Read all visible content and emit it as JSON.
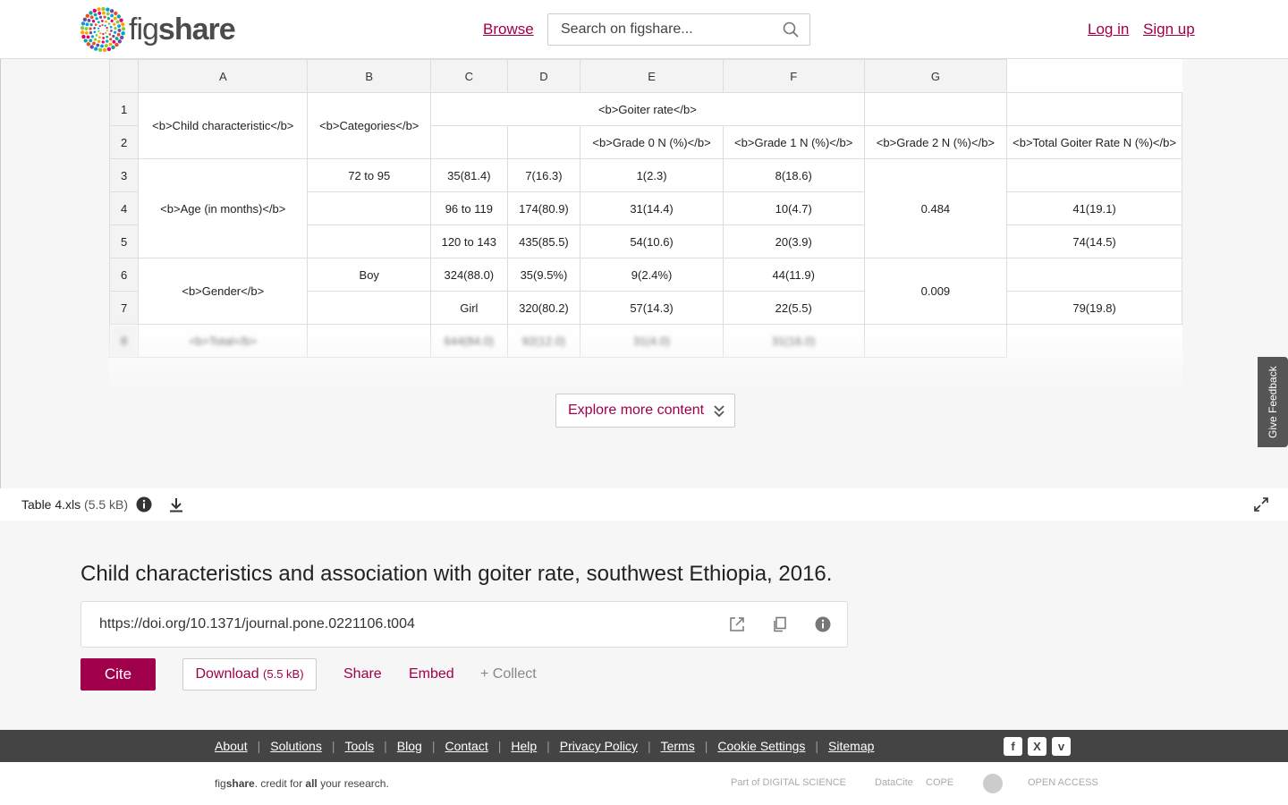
{
  "header": {
    "logo_prefix": "fig",
    "logo_suffix": "share",
    "browse": "Browse",
    "search_placeholder": "Search on figshare...",
    "login": "Log in",
    "signup": "Sign up"
  },
  "sheet": {
    "columns": [
      "A",
      "B",
      "C",
      "D",
      "E",
      "F",
      "G"
    ],
    "row_numbers": [
      "1",
      "2",
      "3",
      "4",
      "5",
      "6",
      "7",
      "8"
    ],
    "r1": {
      "A": "<b>Child characteristic</b>",
      "B": "<b>Categories</b>",
      "CDE": "<b>Goiter rate</b>"
    },
    "r2": {
      "E": "<b>Grade 0 N (%)</b>",
      "F": "<b>Grade 1 N (%)</b>",
      "G": "<b>Grade 2 N (%)</b>",
      "H": "<b>Total Goiter Rate N (%)</b>"
    },
    "r3": {
      "B": "72 to 95",
      "C": "35(81.4)",
      "D": "7(16.3)",
      "E": "1(2.3)",
      "F": "8(18.6)"
    },
    "r4": {
      "A": "<b>Age (in months)</b>",
      "C": "96 to 119",
      "D": "174(80.9)",
      "E": "31(14.4)",
      "F": "10(4.7)",
      "G": "0.484",
      "H": "41(19.1)"
    },
    "r5": {
      "C": "120 to 143",
      "D": "435(85.5)",
      "E": "54(10.6)",
      "F": "20(3.9)",
      "H": "74(14.5)"
    },
    "r6": {
      "B": "Boy",
      "C": "324(88.0)",
      "D": "35(9.5%)",
      "E": "9(2.4%)",
      "F": "44(11.9)"
    },
    "r7": {
      "A": "<b>Gender</b>",
      "C": "Girl",
      "D": "320(80.2)",
      "E": "57(14.3)",
      "F": "22(5.5)",
      "G": "0.009",
      "H": "79(19.8)"
    },
    "r8": {
      "A": "<b>Total</b>",
      "C": "644(84.0)",
      "D": "92(12.0)",
      "E": "31(4.0)",
      "F": "31(16.0)"
    }
  },
  "explore_label": "Explore more content",
  "feedback_label": "Give Feedback",
  "file": {
    "name": "Table 4.xls",
    "size": "(5.5 kB)"
  },
  "item": {
    "title": "Child characteristics and association with goiter rate, southwest Ethiopia, 2016.",
    "doi": "https://doi.org/10.1371/journal.pone.0221106.t004",
    "cite": "Cite",
    "download": "Download",
    "download_size": "(5.5 kB)",
    "share": "Share",
    "embed": "Embed",
    "collect": "+ Collect"
  },
  "footer": {
    "links": [
      "About",
      "Solutions",
      "Tools",
      "Blog",
      "Contact",
      "Help",
      "Privacy Policy",
      "Terms",
      "Cookie Settings",
      "Sitemap"
    ],
    "social": [
      "f",
      "X",
      "v"
    ],
    "tagline_pre": "fig",
    "tagline_brand": "share",
    "tagline_mid": ". credit for ",
    "tagline_all": "all",
    "tagline_post": " your research.",
    "partners": [
      "Part of DIGITAL SCIENCE",
      "DataCite",
      "COPE",
      "OPEN ACCESS"
    ]
  },
  "colors": {
    "accent": "#a0004b",
    "footer_bg": "#444444",
    "panel_bg": "#f6f6f6"
  }
}
